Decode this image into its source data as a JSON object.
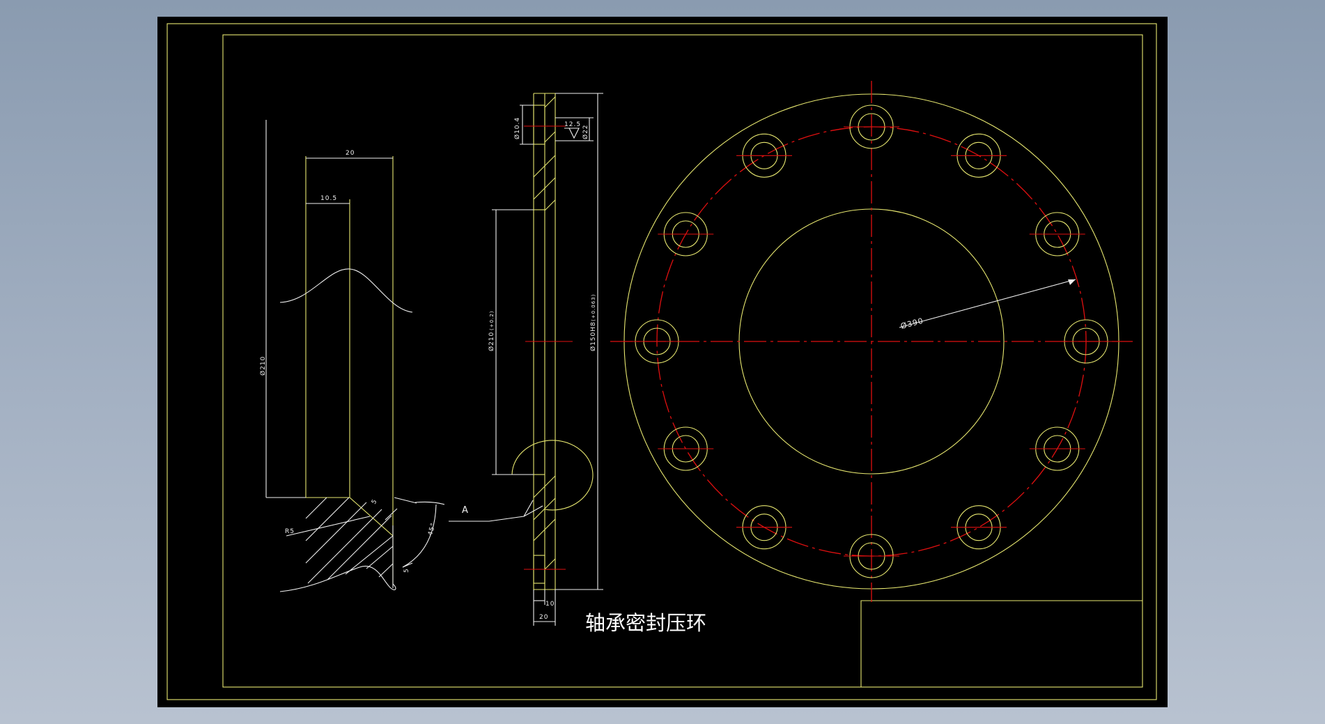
{
  "drawing": {
    "title": "轴承密封压环",
    "detail_label": "A",
    "colors": {
      "background": "#000000",
      "geometry": "#e8e870",
      "annotation": "#f0f0f0",
      "centerline": "#e01010"
    }
  },
  "dimensions": {
    "detail_width": "20",
    "detail_depth": "10.5",
    "detail_diameter": "Ø210",
    "fillet": "R5",
    "chamfer_1": "5",
    "chamfer_2": "5",
    "angle": "45°",
    "hole_dia": "Ø10.4",
    "roughness": "12.5",
    "counterbore_dia": "Ø22",
    "bore_dia": "Ø210",
    "bore_tol": "(+0.2)",
    "spigot_dia": "Ø150H8",
    "spigot_tol": "(+0.063)",
    "thick_small": "10",
    "thick_total": "20",
    "bolt_circle_dia": "Ø390"
  },
  "bolt_pattern": {
    "hole_count": 12
  }
}
